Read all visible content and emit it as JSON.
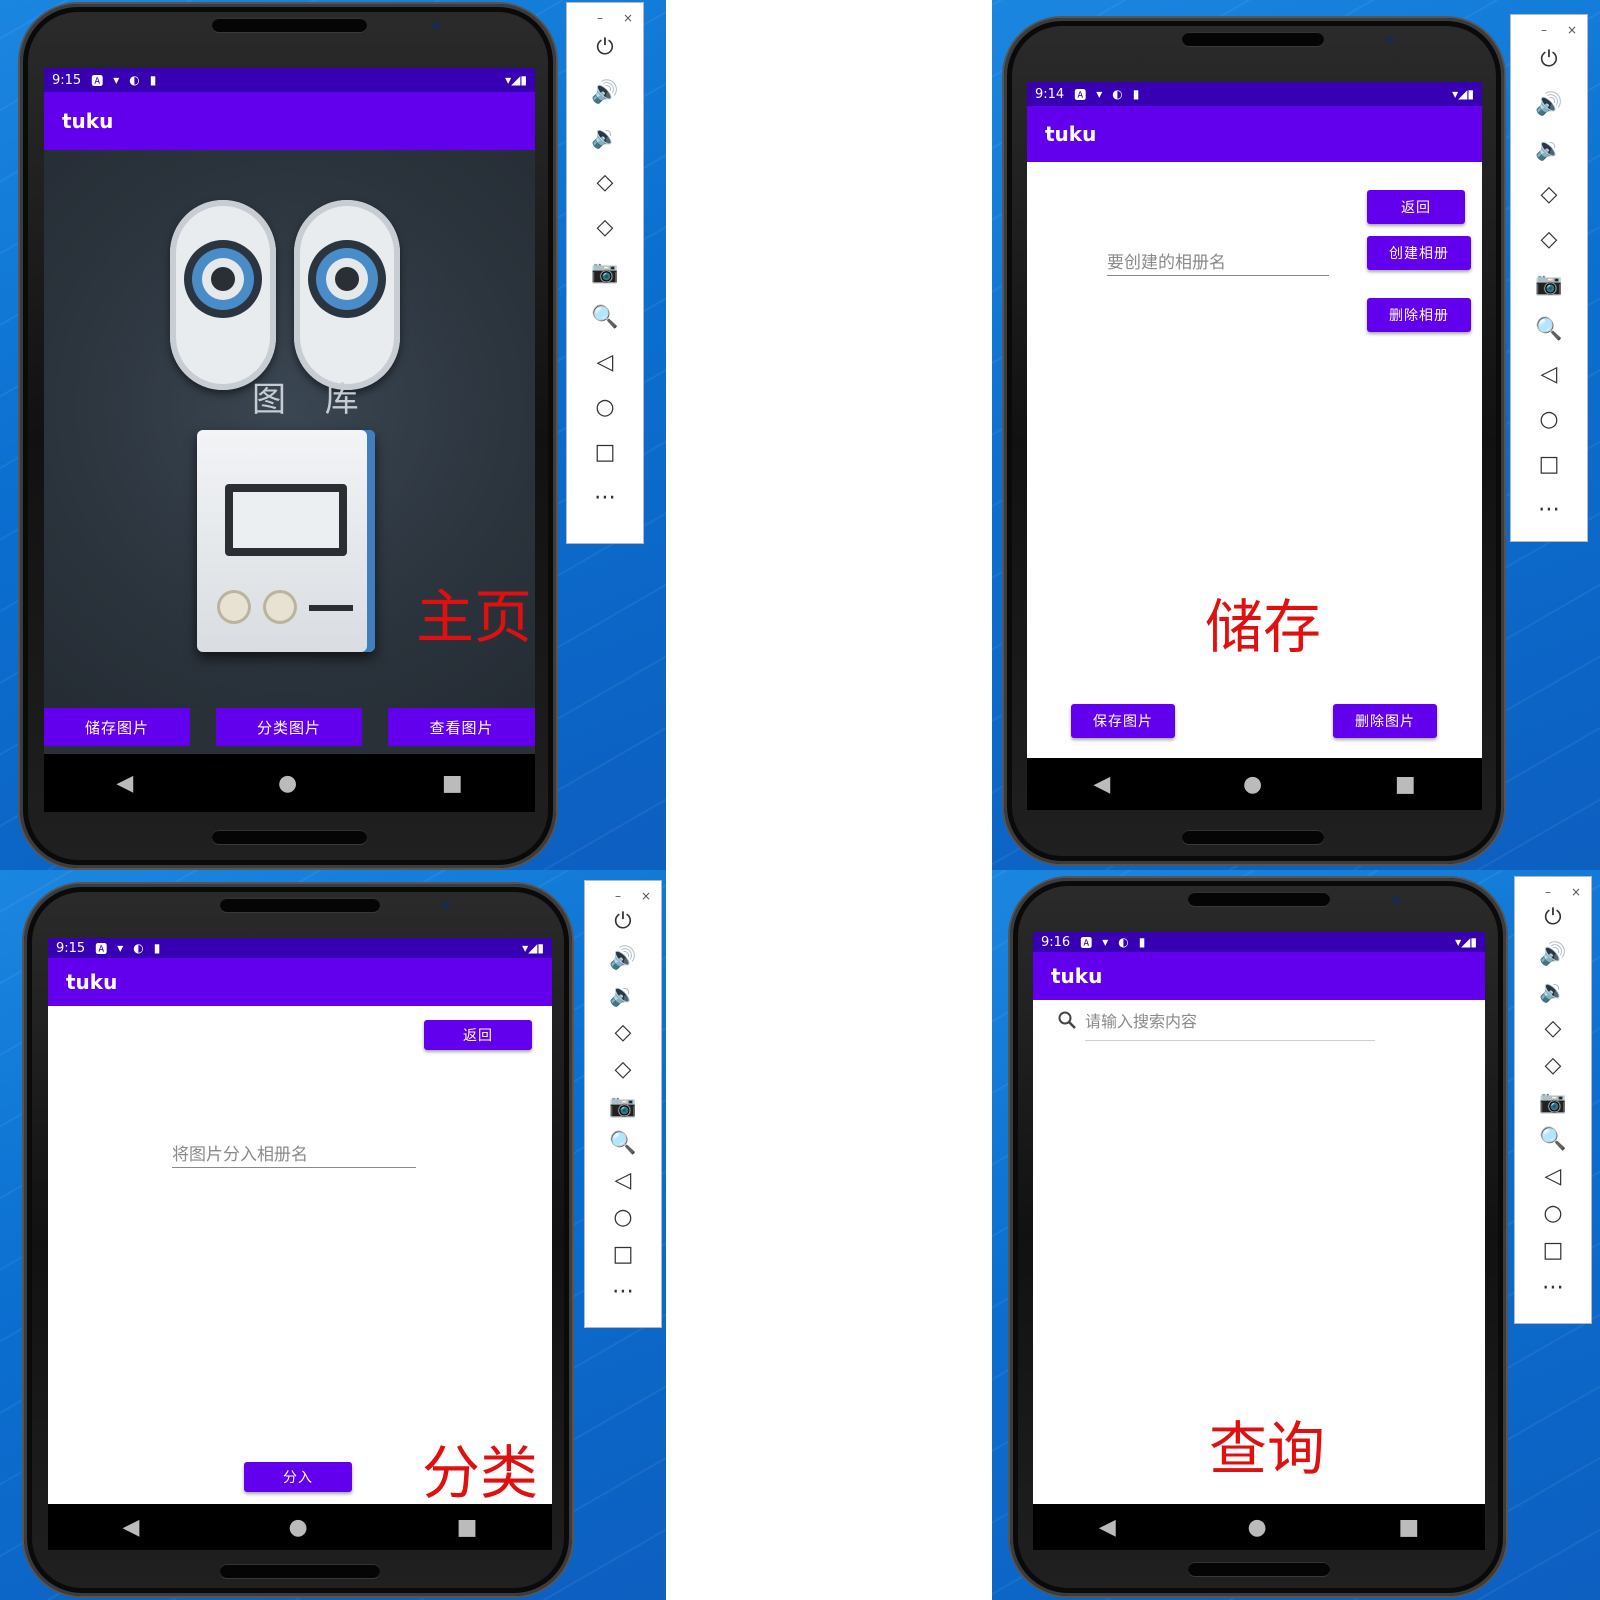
{
  "app": {
    "title": "tuku"
  },
  "status_icons": {
    "left": [
      "🅰",
      "▾",
      "◐",
      "▮"
    ],
    "right": "▾◢▮"
  },
  "nav_icons": {
    "back": "◀",
    "home": "●",
    "recents": "■"
  },
  "panel_icons": {
    "minimize": "–",
    "close": "×",
    "items": [
      "⏻",
      "🔊",
      "🔉",
      "◇",
      "◇",
      "📷",
      "🔍",
      "◁",
      "○",
      "□",
      "⋯"
    ]
  },
  "home": {
    "time": "9:15",
    "art_text": "图 库",
    "buttons": [
      "储存图片",
      "分类图片",
      "查看图片"
    ],
    "label": "主页"
  },
  "storage": {
    "time": "9:14",
    "back_label": "返回",
    "create_album_label": "创建相册",
    "delete_album_label": "删除相册",
    "album_name_placeholder": "要创建的相册名",
    "save_image_label": "保存图片",
    "delete_image_label": "删除图片",
    "label": "储存"
  },
  "classify": {
    "time": "9:15",
    "back_label": "返回",
    "album_name_placeholder": "将图片分入相册名",
    "assign_label": "分入",
    "label": "分类"
  },
  "search": {
    "time": "9:16",
    "placeholder": "请输入搜索内容",
    "label": "查询"
  },
  "colors": {
    "primary": "#6200ee",
    "status_bar": "#3700b3",
    "label_red": "#e01010"
  }
}
